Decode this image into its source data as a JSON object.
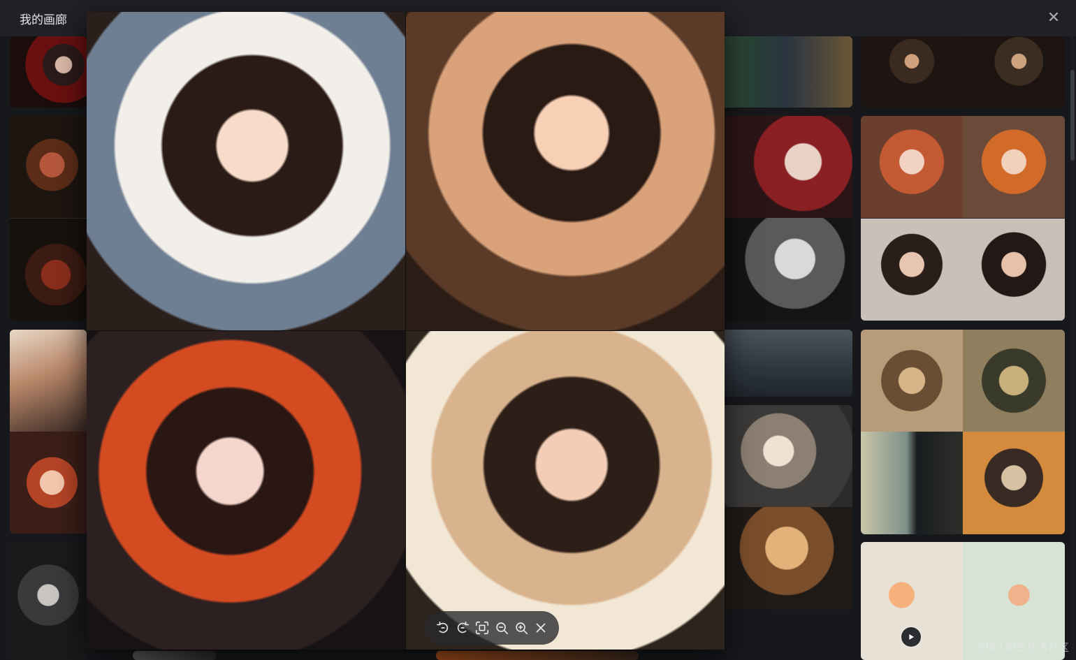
{
  "window": {
    "title": "我的画廊"
  },
  "preview": {
    "toolbar": {
      "rotate_left": "rotate-left-icon",
      "rotate_right": "rotate-right-icon",
      "fit": "fit-screen-icon",
      "zoom_out": "zoom-out-icon",
      "zoom_in": "zoom-in-icon",
      "close": "close-icon"
    }
  },
  "watermark": "@稀土掘金技术社区",
  "colors": {
    "title_bar": "#202126",
    "gallery_bg": "#17181c",
    "toolbar_bg": "#28282c"
  }
}
